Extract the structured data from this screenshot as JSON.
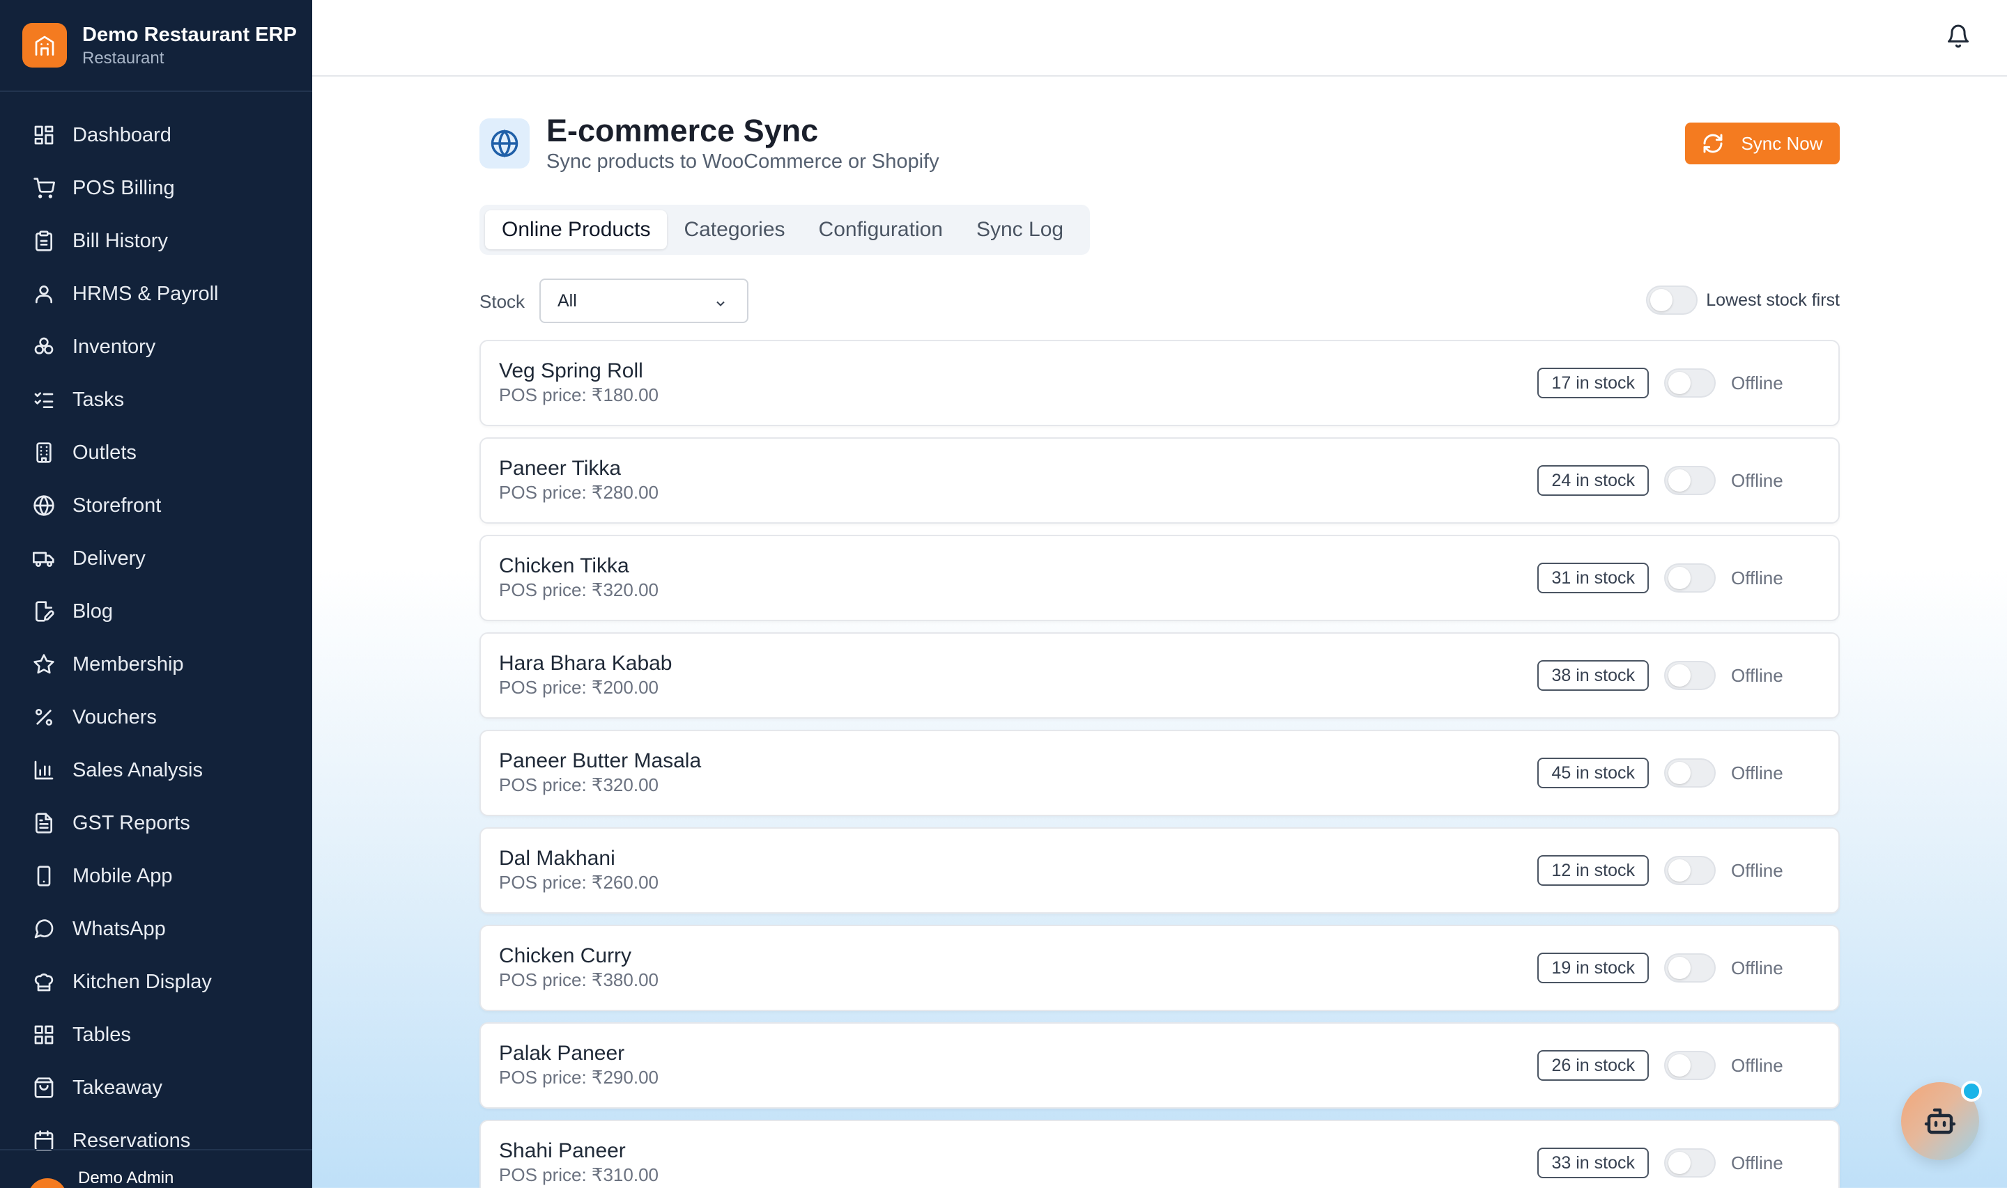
{
  "brand": {
    "title": "Demo Restaurant ERP",
    "subtitle": "Restaurant"
  },
  "colors": {
    "sidebar_bg": "#12223a",
    "accent": "#f47b20",
    "online_icon_bg": "#e0eefc"
  },
  "sidebar": {
    "items": [
      {
        "label": "Dashboard",
        "icon": "dashboard-icon"
      },
      {
        "label": "POS Billing",
        "icon": "cart-icon"
      },
      {
        "label": "Bill History",
        "icon": "clipboard-icon"
      },
      {
        "label": "HRMS & Payroll",
        "icon": "user-icon"
      },
      {
        "label": "Inventory",
        "icon": "boxes-icon"
      },
      {
        "label": "Tasks",
        "icon": "checklist-icon"
      },
      {
        "label": "Outlets",
        "icon": "building-icon"
      },
      {
        "label": "Storefront",
        "icon": "globe-icon"
      },
      {
        "label": "Delivery",
        "icon": "truck-icon"
      },
      {
        "label": "Blog",
        "icon": "file-pen-icon"
      },
      {
        "label": "Membership",
        "icon": "star-icon"
      },
      {
        "label": "Vouchers",
        "icon": "percent-icon"
      },
      {
        "label": "Sales Analysis",
        "icon": "bar-chart-icon"
      },
      {
        "label": "GST Reports",
        "icon": "file-text-icon"
      },
      {
        "label": "Mobile App",
        "icon": "smartphone-icon"
      },
      {
        "label": "WhatsApp",
        "icon": "message-circle-icon"
      },
      {
        "label": "Kitchen Display",
        "icon": "chef-hat-icon"
      },
      {
        "label": "Tables",
        "icon": "grid-icon"
      },
      {
        "label": "Takeaway",
        "icon": "shopping-bag-icon"
      },
      {
        "label": "Reservations",
        "icon": "calendar-icon"
      }
    ],
    "footer_user": "Demo Admin"
  },
  "header": {
    "title": "E-commerce Sync",
    "subtitle": "Sync products to WooCommerce or Shopify",
    "sync_button": "Sync Now"
  },
  "tabs": [
    "Online Products",
    "Categories",
    "Configuration",
    "Sync Log"
  ],
  "active_tab": "Online Products",
  "filter": {
    "stock_label": "Stock",
    "stock_value": "All",
    "lowest_first_label": "Lowest stock first",
    "lowest_first_on": false
  },
  "products": [
    {
      "name": "Veg Spring Roll",
      "price": "POS price: ₹180.00",
      "stock": "17 in stock",
      "status": "Offline"
    },
    {
      "name": "Paneer Tikka",
      "price": "POS price: ₹280.00",
      "stock": "24 in stock",
      "status": "Offline"
    },
    {
      "name": "Chicken Tikka",
      "price": "POS price: ₹320.00",
      "stock": "31 in stock",
      "status": "Offline"
    },
    {
      "name": "Hara Bhara Kabab",
      "price": "POS price: ₹200.00",
      "stock": "38 in stock",
      "status": "Offline"
    },
    {
      "name": "Paneer Butter Masala",
      "price": "POS price: ₹320.00",
      "stock": "45 in stock",
      "status": "Offline"
    },
    {
      "name": "Dal Makhani",
      "price": "POS price: ₹260.00",
      "stock": "12 in stock",
      "status": "Offline"
    },
    {
      "name": "Chicken Curry",
      "price": "POS price: ₹380.00",
      "stock": "19 in stock",
      "status": "Offline"
    },
    {
      "name": "Palak Paneer",
      "price": "POS price: ₹290.00",
      "stock": "26 in stock",
      "status": "Offline"
    },
    {
      "name": "Shahi Paneer",
      "price": "POS price: ₹310.00",
      "stock": "33 in stock",
      "status": "Offline"
    }
  ]
}
